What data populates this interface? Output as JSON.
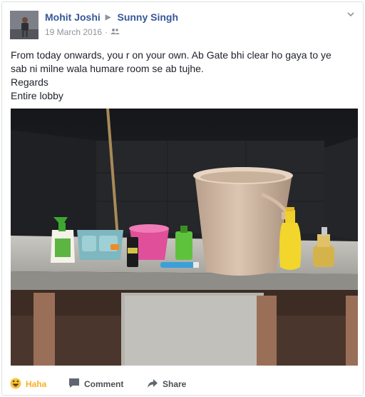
{
  "post": {
    "author": "Mohit Joshi",
    "recipient": "Sunny Singh",
    "date": "19 March 2016",
    "separator": "·",
    "audience_icon": "friends-icon",
    "text_lines": [
      "From today onwards, you r on your own. Ab Gate bhi clear ho gaya to ye",
      "sab ni milne wala humare room se ab tujhe.",
      "Regards",
      "Entire lobby"
    ]
  },
  "actions": {
    "reaction_label": "Haha",
    "reaction_icon": "haha-emoji-icon",
    "comment_label": "Comment",
    "comment_icon": "comment-icon",
    "share_label": "Share",
    "share_icon": "share-icon"
  },
  "colors": {
    "name_link": "#365899",
    "meta_text": "#90949c",
    "haha_active": "#f7b125"
  }
}
